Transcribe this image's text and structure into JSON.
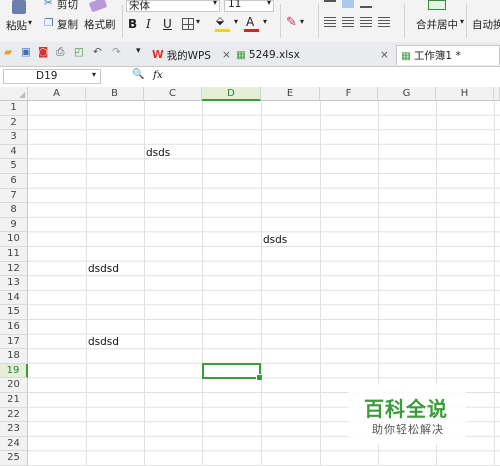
{
  "ribbon": {
    "paste": "粘贴",
    "cut": "剪切",
    "copy": "复制",
    "format_painter": "格式刷",
    "font_name": "宋体",
    "font_size": "11",
    "bold": "B",
    "italic": "I",
    "underline": "U",
    "font_color_glyph": "A",
    "merge_center": "合并居中",
    "auto_wrap": "自动换行"
  },
  "tabs": {
    "mywps": "我的WPS",
    "file1": "5249.xlsx",
    "workbook": "工作簿1 *"
  },
  "formula_bar": {
    "name_box": "D19",
    "fx": "fx",
    "zoom_glyph": "🔍"
  },
  "columns": [
    "A",
    "B",
    "C",
    "D",
    "E",
    "F",
    "G",
    "H"
  ],
  "rows": [
    "1",
    "2",
    "3",
    "4",
    "5",
    "6",
    "7",
    "8",
    "9",
    "10",
    "11",
    "12",
    "13",
    "14",
    "15",
    "16",
    "17",
    "18",
    "19",
    "20",
    "21",
    "22",
    "23",
    "24",
    "25"
  ],
  "cells": {
    "C4": "dsds",
    "E10": "dsds",
    "B12": "dsdsd",
    "B17": "dsdsd"
  },
  "watermark": {
    "title": "百科全说",
    "subtitle": "助你轻松解决"
  },
  "colors": {
    "active_green": "#3c9b3a",
    "header_bg": "#f2f2f2",
    "wps_red": "#d9312d"
  }
}
